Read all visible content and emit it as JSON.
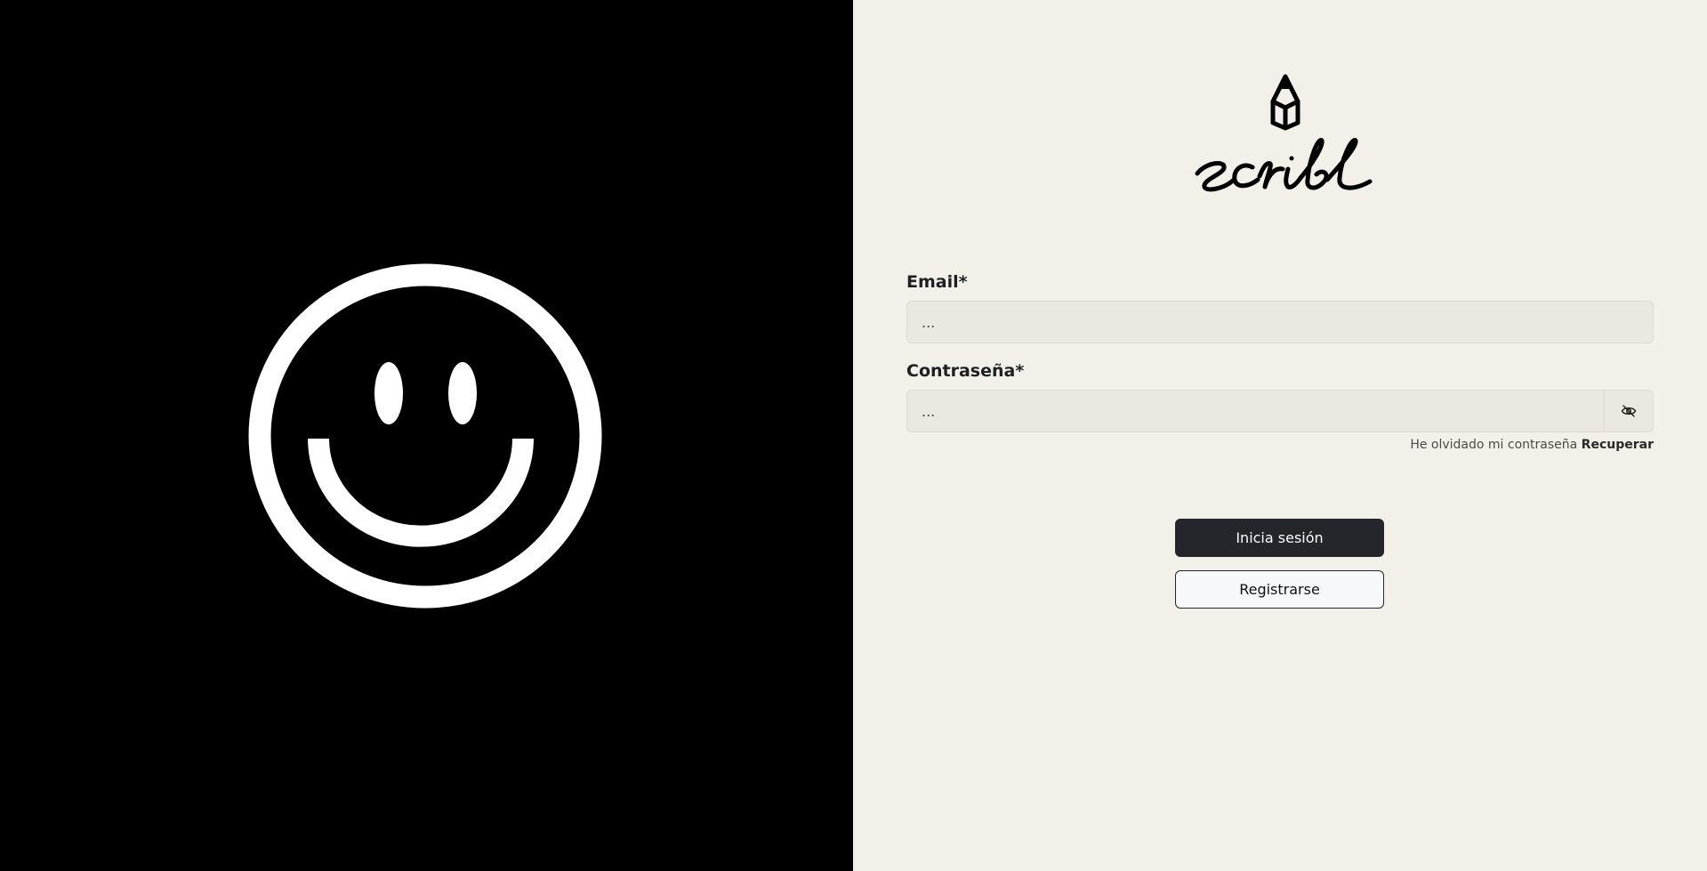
{
  "brand": {
    "name": "scribl"
  },
  "hero": {
    "icon": "smiley-face-icon"
  },
  "form": {
    "email_label": "Email*",
    "email_placeholder": "...",
    "password_label": "Contraseña*",
    "password_placeholder": "...",
    "password_toggle_icon": "eye-off-icon",
    "forgot_text": "He olvidado mi contraseña",
    "recover_link": "Recuperar",
    "login_button": "Inicia sesión",
    "register_button": "Registrarse"
  },
  "colors": {
    "left_bg": "#000000",
    "right_bg": "#f3f0ea",
    "primary_button": "#24262b"
  }
}
